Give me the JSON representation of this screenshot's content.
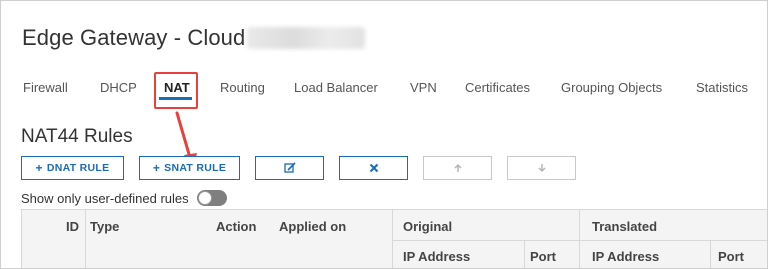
{
  "header": {
    "title": "Edge Gateway - Cloud"
  },
  "tabs": [
    {
      "label": "Firewall",
      "active": false
    },
    {
      "label": "DHCP",
      "active": false
    },
    {
      "label": "NAT",
      "active": true
    },
    {
      "label": "Routing",
      "active": false
    },
    {
      "label": "Load Balancer",
      "active": false
    },
    {
      "label": "VPN",
      "active": false
    },
    {
      "label": "Certificates",
      "active": false
    },
    {
      "label": "Grouping Objects",
      "active": false
    },
    {
      "label": "Statistics",
      "active": false
    }
  ],
  "section": {
    "title": "NAT44 Rules"
  },
  "toolbar": {
    "dnat_label": "DNAT RULE",
    "snat_label": "SNAT RULE",
    "edit_icon": "edit-icon",
    "delete_icon": "close-icon",
    "move_up_icon": "arrow-up-icon",
    "move_down_icon": "arrow-down-icon"
  },
  "filter": {
    "label": "Show only user-defined rules",
    "enabled": false
  },
  "table": {
    "columns": {
      "id": "ID",
      "type": "Type",
      "action": "Action",
      "applied_on": "Applied on",
      "original": "Original",
      "translated": "Translated",
      "orig_ip": "IP Address",
      "orig_port": "Port",
      "trans_ip": "IP Address",
      "trans_port": "Port"
    }
  },
  "colors": {
    "accent": "#1a6bb8",
    "callout": "#e8403c"
  }
}
